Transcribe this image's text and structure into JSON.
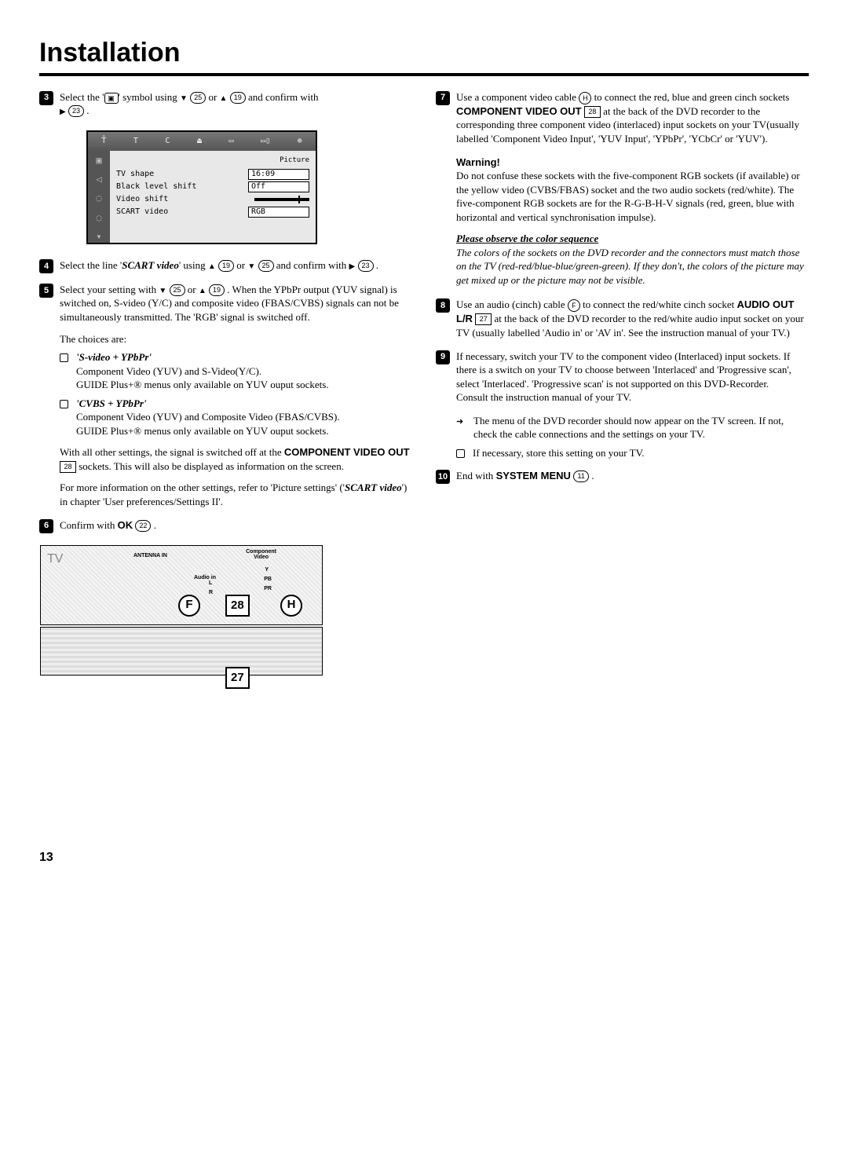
{
  "title": "Installation",
  "page_number": "13",
  "osd": {
    "panel_label": "Picture",
    "rows": [
      {
        "k": "TV shape",
        "v": "16:09"
      },
      {
        "k": "Black level shift",
        "v": "Off"
      },
      {
        "k": "Video shift",
        "v": "__slider__"
      },
      {
        "k": "SCART video",
        "v": "RGB"
      }
    ],
    "top_icons": "TÅ   T   C   ⏏   ▭   ▭▯   🔍"
  },
  "steps_left": {
    "s3": {
      "pre": "Select the '",
      "symbol": "◻︎",
      "mid1": "' symbol using ",
      "d25": "25",
      "or1": " or ",
      "u19": "19",
      "mid2": " and confirm with ",
      "r23": "23",
      "dot": " ."
    },
    "s4": {
      "pre": "Select the line '",
      "scart": "SCART video",
      "mid1": "' using ",
      "u19": "19",
      "or1": " or ",
      "d25": "25",
      "mid2": " and confirm with ",
      "r23": "23",
      "dot": " ."
    },
    "s5": {
      "pre": "Select your setting with ",
      "d25": "25",
      "or1": " or ",
      "u19": "19",
      "tail": " . When the YPbPr output (YUV signal) is switched on, S-video (Y/C) and composite video (FBAS/CVBS) signals can not be simultaneously transmitted. The 'RGB' signal is switched off.",
      "choices_intro": "The choices are:",
      "choice1_title": "'S-video + YPbPr'",
      "choice1_line1": "Component Video (YUV) and S-Video(Y/C).",
      "choice1_line2": "GUIDE Plus+® menus only available on YUV ouput sockets.",
      "choice2_title": "'CVBS + YPbPr'",
      "choice2_line1": "Component Video (YUV) and Composite Video (FBAS/CVBS).",
      "choice2_line2": "GUIDE Plus+® menus only available on YUV ouput sockets.",
      "tail2a": "With all other settings, the signal is switched off at the ",
      "cvo": "COMPONENT VIDEO OUT",
      "ref28": "28",
      "tail2b": " sockets. This will also be displayed as information on the screen.",
      "tail3a": "For more information on the other settings, refer to 'Picture settings' ('",
      "scart2": "SCART video",
      "tail3b": "') in chapter 'User preferences/Settings II'."
    },
    "s6": {
      "pre": "Confirm with ",
      "ok": "OK",
      "ref22": "22",
      "dot": " ."
    }
  },
  "steps_right": {
    "s7": {
      "pre": "Use a component video cable ",
      "refH": "H",
      "mid1": " to connect the red, blue and green cinch sockets ",
      "cvo": "COMPONENT VIDEO OUT",
      "ref28": "28",
      "tail": " at the back of the DVD recorder to the corresponding three component video (interlaced) input sockets on your TV(usually labelled 'Component Video Input', 'YUV Input', 'YPbPr', 'YCbCr' or 'YUV')."
    },
    "warning": {
      "title": "Warning!",
      "body": "Do not confuse these sockets with the five-component RGB sockets (if available) or the yellow video (CVBS/FBAS) socket and the two audio sockets (red/white). The five-component RGB sockets are for the R-G-B-H-V signals (red, green, blue with horizontal and vertical synchronisation impulse).",
      "color_title": "Please observe the color sequence",
      "color_body": "The colors of the sockets on the DVD recorder and the connectors must match those on the TV (red-red/blue-blue/green-green). If they don't, the colors of the picture may get mixed up or the picture may not be visible."
    },
    "s8": {
      "pre": "Use an audio (cinch) cable ",
      "refF": "F",
      "mid1": " to connect the red/white cinch socket ",
      "aolr": "AUDIO OUT L/R",
      "ref27": "27",
      "tail": " at the back of the DVD recorder to the red/white audio input socket on your TV (usually labelled 'Audio in' or 'AV in'. See the instruction manual of your TV.)"
    },
    "s9": {
      "body": "If necessary, switch your TV to the component video (Interlaced) input sockets. If there is a switch on your TV to choose between 'Interlaced' and 'Progressive scan', select 'Interlaced'. 'Progressive scan' is not supported on this DVD-Recorder.\nConsult the instruction manual of your TV.",
      "sub_arrow": "The menu of the DVD recorder should now appear on the TV screen. If not, check the cable connections and the settings on your TV.",
      "sub_o": "If necessary, store this setting on your TV."
    },
    "s10": {
      "pre": "End with ",
      "menu": "SYSTEM MENU",
      "ref11": "11",
      "dot": " ."
    }
  },
  "diagram": {
    "tv": "TV",
    "antenna": "ANTENNA IN",
    "component": "Component\nVideo",
    "audio": "Audio in",
    "Y": "Y",
    "Pb": "PB",
    "Pr": "PR",
    "L": "L",
    "R": "R",
    "F": "F",
    "H": "H",
    "n27": "27",
    "n28": "28"
  }
}
